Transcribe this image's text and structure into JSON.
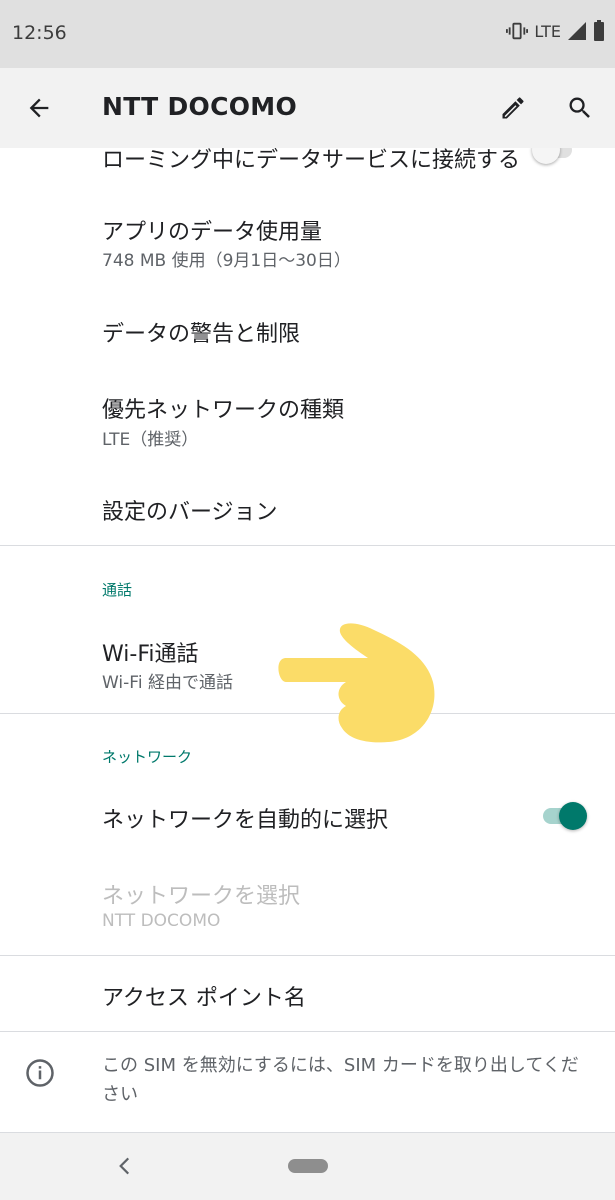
{
  "status_bar": {
    "time": "12:56",
    "network": "LTE"
  },
  "app_bar": {
    "title": "NTT DOCOMO"
  },
  "rows": {
    "roaming": {
      "title": "ローミング中にデータサービスに接続する"
    },
    "app_data_usage": {
      "title": "アプリのデータ使用量",
      "subtitle": "748 MB 使用（9月1日〜30日）"
    },
    "data_warning": {
      "title": "データの警告と制限"
    },
    "preferred_network": {
      "title": "優先ネットワークの種類",
      "subtitle": "LTE（推奨）"
    },
    "carrier_version": {
      "title": "設定のバージョン"
    },
    "wifi_calling": {
      "title": "Wi-Fi通話",
      "subtitle": "Wi-Fi 経由で通話"
    },
    "auto_network": {
      "title": "ネットワークを自動的に選択",
      "toggle_on": true
    },
    "choose_network": {
      "title": "ネットワークを選択",
      "subtitle": "NTT DOCOMO",
      "disabled": true
    },
    "apn": {
      "title": "アクセス ポイント名"
    }
  },
  "sections": {
    "calling": "通話",
    "network": "ネットワーク"
  },
  "info": {
    "text": "この SIM を無効にするには、SIM カードを取り出してください"
  },
  "icons": {
    "back": "arrow-left-icon",
    "edit": "pencil-icon",
    "search": "search-icon",
    "info": "info-icon",
    "vibrate": "vibrate-icon",
    "signal": "signal-icon",
    "battery": "battery-icon",
    "pointer": "pointing-hand-icon"
  },
  "colors": {
    "accent": "#00796b",
    "pointer": "#fbdc68"
  }
}
